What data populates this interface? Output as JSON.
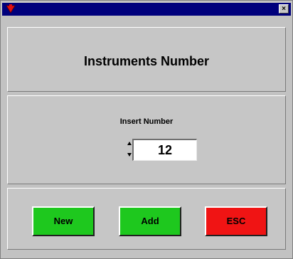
{
  "window": {
    "close_glyph": "×",
    "system_icon": "red-triangle-icon",
    "titlebar_color": "#00007c"
  },
  "header": {
    "title": "Instruments Number"
  },
  "input": {
    "label": "Insert Number",
    "value": "12"
  },
  "buttons": {
    "new_label": "New",
    "add_label": "Add",
    "esc_label": "ESC",
    "new_color": "#1ec81e",
    "add_color": "#1ec81e",
    "esc_color": "#f01414"
  }
}
